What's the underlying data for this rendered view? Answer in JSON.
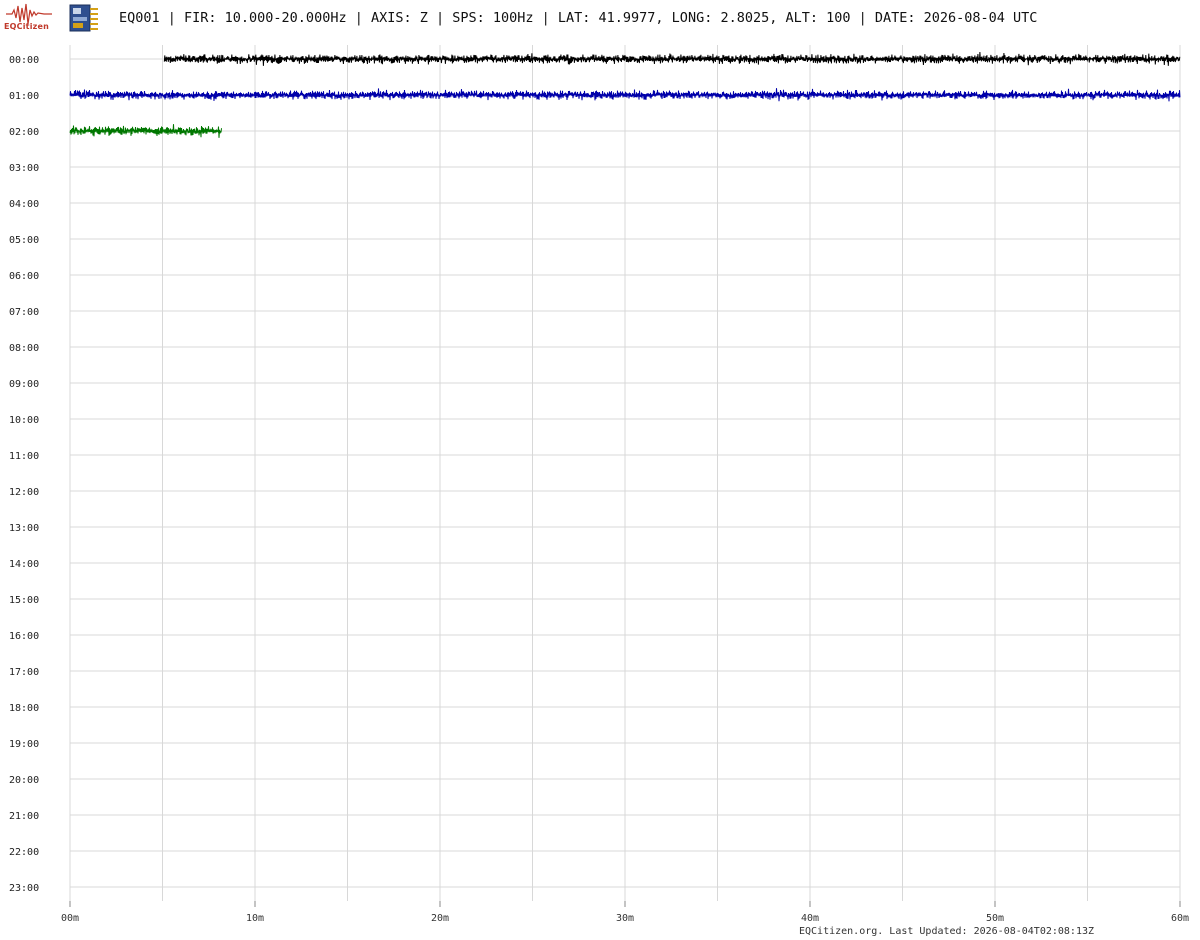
{
  "header": {
    "logo_text": "EQCitizen",
    "title": "EQ001 | FIR: 10.000-20.000Hz | AXIS: Z | SPS: 100Hz | LAT: 41.9977, LONG: 2.8025, ALT: 100 | DATE: 2026-08-04 UTC"
  },
  "footer": {
    "text": "EQCitizen.org. Last Updated: 2026-08-04T02:08:13Z"
  },
  "chart_data": {
    "type": "line",
    "subtype": "helicorder",
    "title": "",
    "x_axis": {
      "unit": "minutes",
      "range": [
        0,
        60
      ],
      "tick_labels": [
        "00m",
        "10m",
        "20m",
        "30m",
        "40m",
        "50m",
        "60m"
      ],
      "tick_values": [
        0,
        10,
        20,
        30,
        40,
        50,
        60
      ],
      "minor_grid_every": 5
    },
    "y_axis": {
      "row_labels": [
        "00:00",
        "01:00",
        "02:00",
        "03:00",
        "04:00",
        "05:00",
        "06:00",
        "07:00",
        "08:00",
        "09:00",
        "10:00",
        "11:00",
        "12:00",
        "13:00",
        "14:00",
        "15:00",
        "16:00",
        "17:00",
        "18:00",
        "19:00",
        "20:00",
        "21:00",
        "22:00",
        "23:00"
      ]
    },
    "grid": true,
    "traces": [
      {
        "row": "00:00",
        "start_min": 5.1,
        "end_min": 60,
        "color": "#000000"
      },
      {
        "row": "01:00",
        "start_min": 0,
        "end_min": 60,
        "color": "#0000aa"
      },
      {
        "row": "02:00",
        "start_min": 0,
        "end_min": 8.2,
        "color": "#007700"
      }
    ]
  }
}
